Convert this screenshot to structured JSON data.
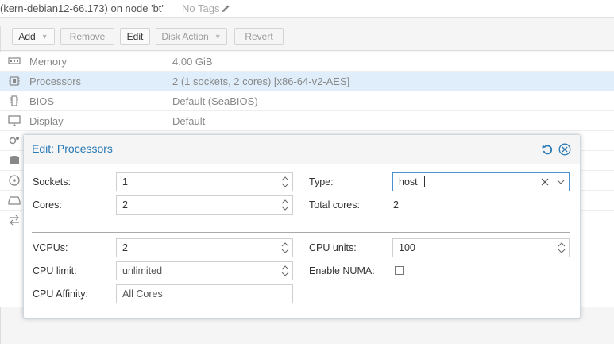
{
  "header": {
    "title": "(kern-debian12-66.173) on node 'bt'",
    "tags": "No Tags"
  },
  "toolbar": {
    "add": "Add",
    "remove": "Remove",
    "edit": "Edit",
    "disk_action": "Disk Action",
    "revert": "Revert"
  },
  "hardware": {
    "rows": [
      {
        "key": "Memory",
        "value": "4.00 GiB",
        "icon": "memory-icon"
      },
      {
        "key": "Processors",
        "value": "2 (1 sockets, 2 cores) [x86-64-v2-AES]",
        "icon": "cpu-icon"
      },
      {
        "key": "BIOS",
        "value": "Default (SeaBIOS)",
        "icon": "bios-icon"
      },
      {
        "key": "Display",
        "value": "Default",
        "icon": "display-icon"
      }
    ]
  },
  "dialog": {
    "title": "Edit: Processors",
    "sockets_label": "Sockets:",
    "sockets_value": "1",
    "cores_label": "Cores:",
    "cores_value": "2",
    "type_label": "Type:",
    "type_value": "host",
    "total_cores_label": "Total cores:",
    "total_cores_value": "2",
    "vcpus_label": "VCPUs:",
    "vcpus_value": "2",
    "cpu_units_label": "CPU units:",
    "cpu_units_value": "100",
    "cpu_limit_label": "CPU limit:",
    "cpu_limit_value": "unlimited",
    "numa_label": "Enable NUMA:",
    "numa_checked": false,
    "affinity_label": "CPU Affinity:",
    "affinity_value": "All Cores"
  },
  "colors": {
    "accent": "#2979b5",
    "selected_row": "#dfeefa"
  }
}
